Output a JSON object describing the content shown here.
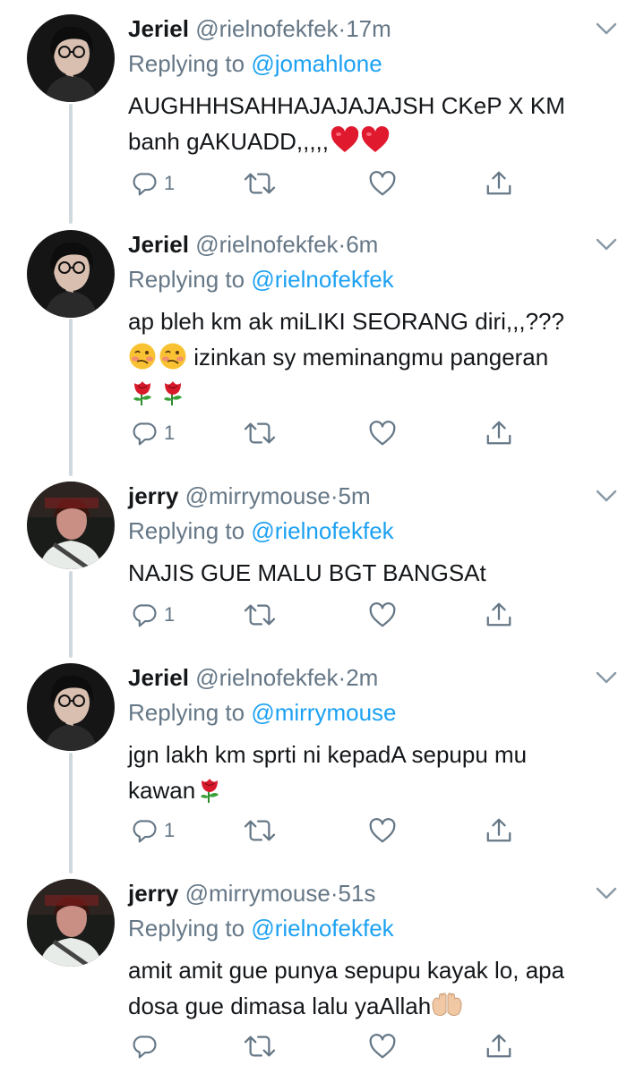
{
  "tweets": [
    {
      "name": "Jeriel",
      "handle": "@rielnofekfek",
      "separator": "·",
      "time": "17m",
      "reply_prefix": "Replying to ",
      "reply_to": "@jomahlone",
      "text_line1": "AUGHHHSAHHAJAJAJAJSH CKeP X KM",
      "text_line2": "banh gAKUADD,,,,,",
      "reply_count": "1",
      "avatar": "avatar-jeriel"
    },
    {
      "name": "Jeriel",
      "handle": "@rielnofekfek",
      "separator": "·",
      "time": "6m",
      "reply_prefix": "Replying to ",
      "reply_to": "@rielnofekfek",
      "text_line1": "ap bleh km ak miLIKI SEORANG diri,,,???",
      "text_line2": "izinkan sy meminangmu pangeran",
      "reply_count": "1",
      "avatar": "avatar-jeriel"
    },
    {
      "name": "jerry",
      "handle": "@mirrymouse",
      "separator": "·",
      "time": "5m",
      "reply_prefix": "Replying to ",
      "reply_to": "@rielnofekfek",
      "text_line1": "NAJIS GUE MALU BGT BANGSAt",
      "reply_count": "1",
      "avatar": "avatar-jerry"
    },
    {
      "name": "Jeriel",
      "handle": "@rielnofekfek",
      "separator": "·",
      "time": "2m",
      "reply_prefix": "Replying to ",
      "reply_to": "@mirrymouse",
      "text_line1": "jgn lakh km sprti ni kepadA sepupu mu",
      "text_line2": "kawan",
      "reply_count": "1",
      "avatar": "avatar-jeriel"
    },
    {
      "name": "jerry",
      "handle": "@mirrymouse",
      "separator": "·",
      "time": "51s",
      "reply_prefix": "Replying to ",
      "reply_to": "@rielnofekfek",
      "text_line1": "amit amit gue punya sepupu kayak lo, apa",
      "text_line2": "dosa gue dimasa lalu yaAllah",
      "avatar": "avatar-jerry"
    }
  ],
  "colors": {
    "link": "#1da1f2",
    "secondary": "#657786",
    "thread_line": "#cfd9de"
  },
  "icons": [
    "reply-icon",
    "retweet-icon",
    "like-icon",
    "share-icon",
    "chevron-down-icon",
    "heart-emoji",
    "woozy-face-emoji",
    "rose-emoji",
    "palms-up-emoji"
  ]
}
